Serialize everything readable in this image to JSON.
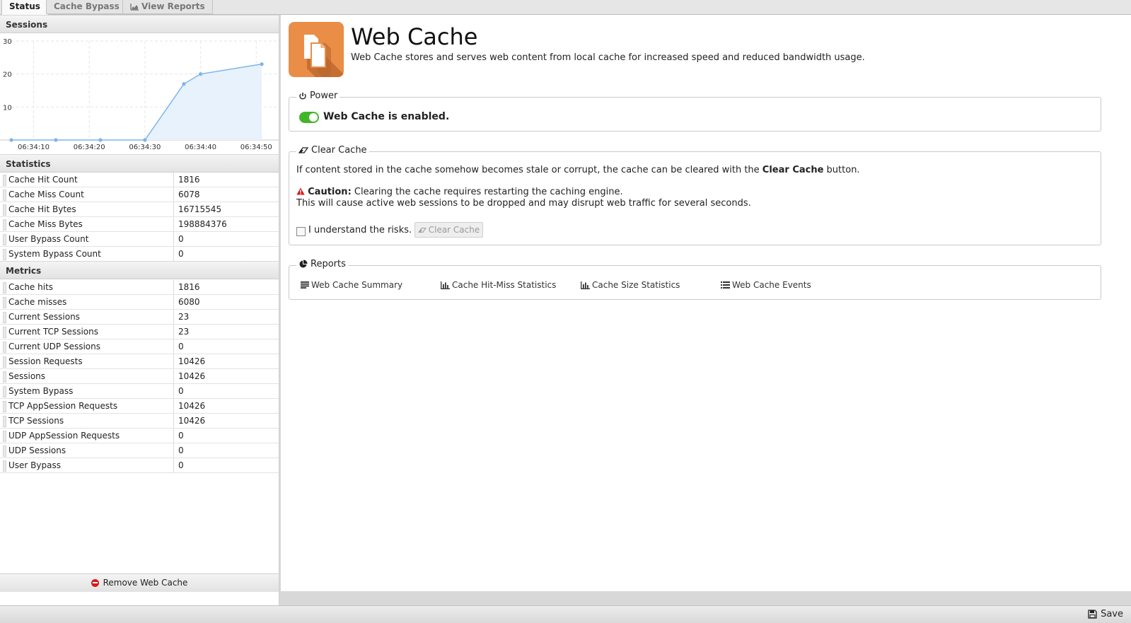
{
  "tabs": {
    "status": "Status",
    "cache_bypass": "Cache Bypass",
    "view_reports": "View Reports"
  },
  "sessions": {
    "heading": "Sessions"
  },
  "chart_data": {
    "type": "area",
    "x": [
      "06:34:06",
      "06:34:14",
      "06:34:22",
      "06:34:30",
      "06:34:37",
      "06:34:40",
      "06:34:51"
    ],
    "x_ticks": [
      "06:34:10",
      "06:34:20",
      "06:34:30",
      "06:34:40",
      "06:34:50"
    ],
    "series": [
      {
        "values": [
          0,
          0,
          0,
          0,
          17,
          20,
          23
        ]
      }
    ],
    "ylim": [
      0,
      30
    ],
    "y_ticks": [
      "10",
      "20",
      "30"
    ],
    "grid": true,
    "line_color": "#7cb5ec",
    "fill_color": "#e8f2fc"
  },
  "statistics": {
    "heading": "Statistics",
    "rows": [
      {
        "k": "Cache Hit Count",
        "v": "1816"
      },
      {
        "k": "Cache Miss Count",
        "v": "6078"
      },
      {
        "k": "Cache Hit Bytes",
        "v": "16715545"
      },
      {
        "k": "Cache Miss Bytes",
        "v": "198884376"
      },
      {
        "k": "User Bypass Count",
        "v": "0"
      },
      {
        "k": "System Bypass Count",
        "v": "0"
      }
    ]
  },
  "metrics": {
    "heading": "Metrics",
    "rows": [
      {
        "k": "Cache hits",
        "v": "1816"
      },
      {
        "k": "Cache misses",
        "v": "6080"
      },
      {
        "k": "Current Sessions",
        "v": "23"
      },
      {
        "k": "Current TCP Sessions",
        "v": "23"
      },
      {
        "k": "Current UDP Sessions",
        "v": "0"
      },
      {
        "k": "Session Requests",
        "v": "10426"
      },
      {
        "k": "Sessions",
        "v": "10426"
      },
      {
        "k": "System Bypass",
        "v": "0"
      },
      {
        "k": "TCP AppSession Requests",
        "v": "10426"
      },
      {
        "k": "TCP Sessions",
        "v": "10426"
      },
      {
        "k": "UDP AppSession Requests",
        "v": "0"
      },
      {
        "k": "UDP Sessions",
        "v": "0"
      },
      {
        "k": "User Bypass",
        "v": "0"
      }
    ]
  },
  "remove_label": "Remove Web Cache",
  "app": {
    "title": "Web Cache",
    "description": "Web Cache stores and serves web content from local cache for increased speed and reduced bandwidth usage.",
    "icon": "documents-icon",
    "icon_color": "#e98d47"
  },
  "power": {
    "legend": "Power",
    "status": "Web Cache is enabled.",
    "enabled": true,
    "toggle_color": "#43b52b"
  },
  "clear_cache": {
    "legend": "Clear Cache",
    "intro_before": "If content stored in the cache somehow becomes stale or corrupt, the cache can be cleared with the ",
    "intro_bold": "Clear Cache",
    "intro_after": " button.",
    "caution_label": "Caution:",
    "caution_text": " Clearing the cache requires restarting the caching engine.",
    "caution_line2": "This will cause active web sessions to be dropped and may disrupt web traffic for several seconds.",
    "checkbox_label": "I understand the risks.",
    "button_label": "Clear Cache"
  },
  "reports": {
    "legend": "Reports",
    "links": [
      {
        "label": "Web Cache Summary",
        "icon": "text-lines-icon"
      },
      {
        "label": "Cache Hit-Miss Statistics",
        "icon": "bar-chart-icon"
      },
      {
        "label": "Cache Size Statistics",
        "icon": "bar-chart-icon"
      },
      {
        "label": "Web Cache Events",
        "icon": "list-icon"
      }
    ]
  },
  "save_label": "Save"
}
